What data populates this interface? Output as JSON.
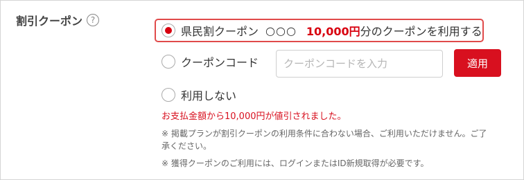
{
  "section": {
    "title": "割引クーポン",
    "help_icon": "question-circle-icon",
    "help_glyph": "?"
  },
  "options": {
    "prefecture": {
      "label": "県民割クーポン",
      "name_mask": "○○○",
      "amount": "10,000円",
      "suffix": "分のクーポンを利用する",
      "selected": true
    },
    "code": {
      "label": "クーポンコード",
      "placeholder": "クーポンコードを入力",
      "value": "",
      "apply_label": "適用"
    },
    "none": {
      "label": "利用しない"
    }
  },
  "messages": {
    "discount": "お支払金額から10,000円が値引されました。",
    "note1": "※ 掲載プランが割引クーポンの利用条件に合わない場合、ご利用いただけません。ご了承ください。",
    "note2": "※ 獲得クーポンのご利用には、ログインまたはID新規取得が必要です。"
  },
  "colors": {
    "accent": "#d8101f",
    "selected_border": "#e04a4a"
  }
}
